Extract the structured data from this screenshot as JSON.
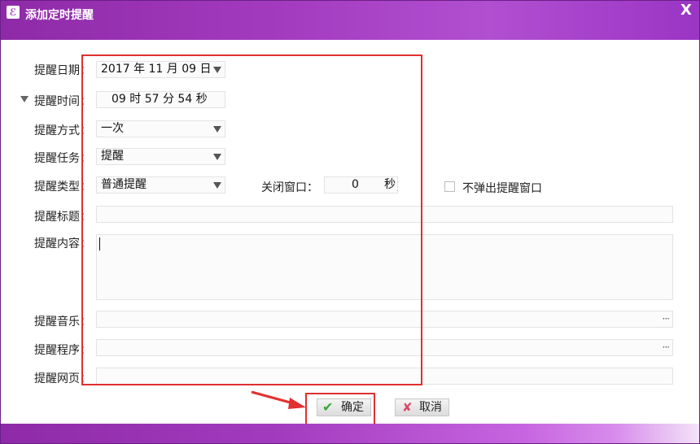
{
  "window": {
    "title": "添加定时提醒",
    "close_glyph": "X"
  },
  "form": {
    "date": {
      "label": "提醒日期：",
      "value": "2017 年 11 月 09 日"
    },
    "time": {
      "label": "提醒时间：",
      "value": "09  时 57 分 54  秒"
    },
    "mode": {
      "label": "提醒方式：",
      "value": "一次"
    },
    "task": {
      "label": "提醒任务：",
      "value": "提醒"
    },
    "type": {
      "label": "提醒类型：",
      "value": "普通提醒"
    },
    "close_window": {
      "label": "关闭窗口：",
      "value": "0",
      "unit": "秒"
    },
    "no_popup": {
      "label": "不弹出提醒窗口",
      "checked": false
    },
    "title": {
      "label": "提醒标题：",
      "value": ""
    },
    "content": {
      "label": "提醒内容：",
      "value": ""
    },
    "music": {
      "label": "提醒音乐：",
      "value": "",
      "browse": "···"
    },
    "program": {
      "label": "提醒程序：",
      "value": "",
      "browse": "···"
    },
    "webpage": {
      "label": "提醒网页：",
      "value": ""
    }
  },
  "buttons": {
    "ok": "确定",
    "cancel": "取消"
  },
  "colors": {
    "title_bar": "#a33bbf",
    "highlight": "#e03030",
    "ok_check": "#3aa63a",
    "cancel_x": "#d94a6a"
  }
}
